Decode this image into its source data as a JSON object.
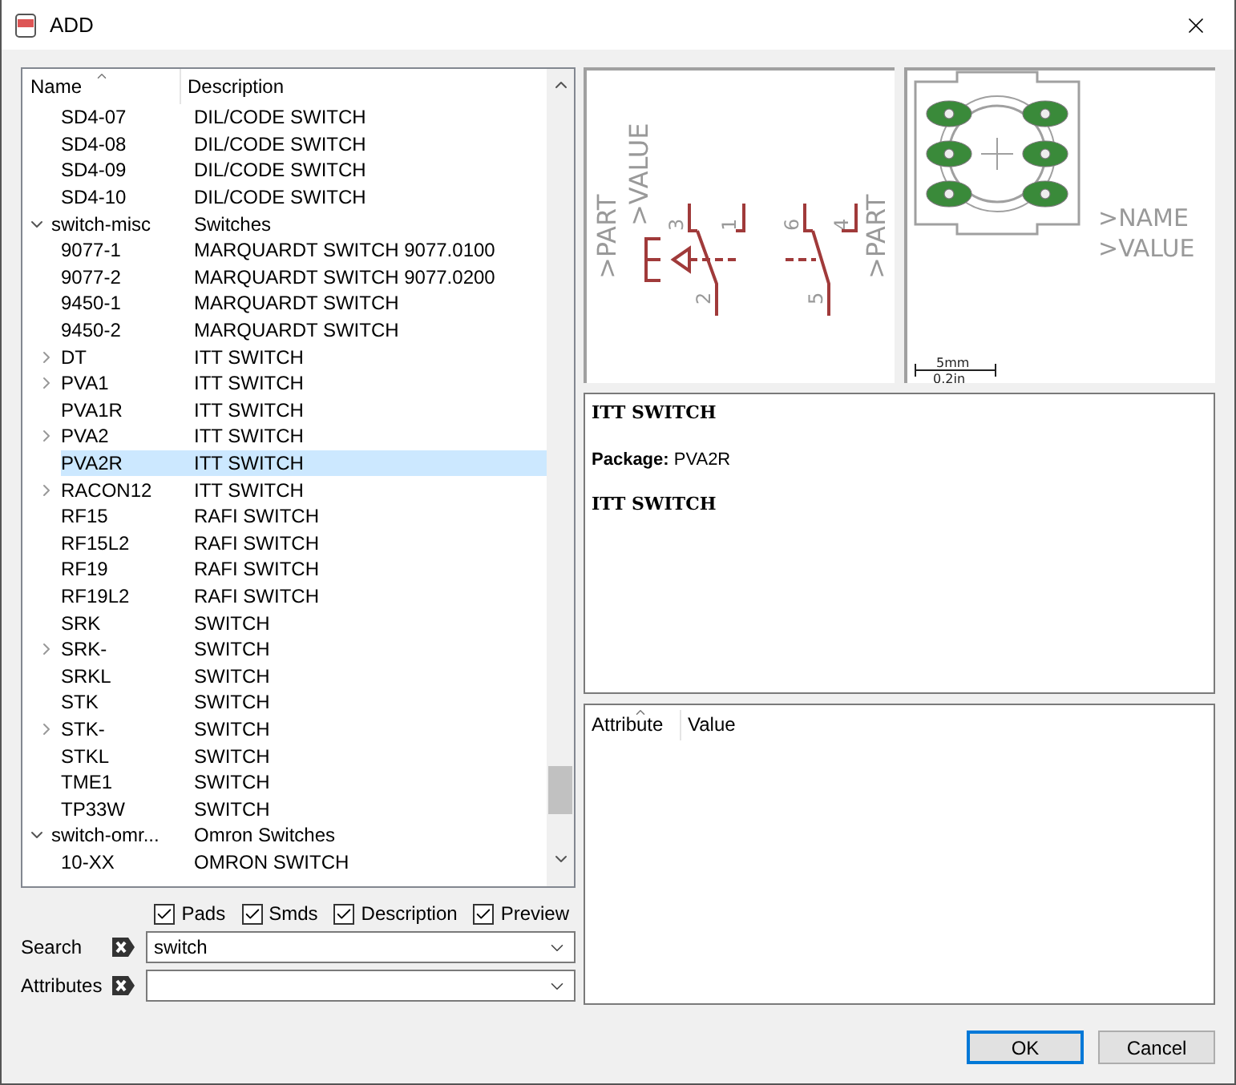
{
  "window": {
    "title": "ADD"
  },
  "tree": {
    "columns": [
      "Name",
      "Description"
    ],
    "rows": [
      {
        "children": [
          {
            "name": "SD4-07",
            "description": "DIL/CODE SWITCH",
            "selected": false
          },
          {
            "name": "SD4-08",
            "description": "DIL/CODE SWITCH",
            "selected": false
          },
          {
            "name": "SD4-09",
            "description": "DIL/CODE SWITCH",
            "selected": false
          },
          {
            "name": "SD4-10",
            "description": "DIL/CODE SWITCH",
            "selected": false
          }
        ]
      },
      {
        "name": "switch-misc",
        "description": "Switches",
        "expanded": true,
        "selected": false,
        "children": [
          {
            "name": "9077-1",
            "description": "MARQUARDT SWITCH 9077.0100",
            "selected": false
          },
          {
            "name": "9077-2",
            "description": "MARQUARDT SWITCH 9077.0200",
            "selected": false
          },
          {
            "name": "9450-1",
            "description": "MARQUARDT SWITCH",
            "selected": false
          },
          {
            "name": "9450-2",
            "description": "MARQUARDT SWITCH",
            "selected": false
          },
          {
            "name": "DT",
            "description": "ITT SWITCH",
            "expanded": false,
            "selected": false
          },
          {
            "name": "PVA1",
            "description": "ITT SWITCH",
            "expanded": false,
            "selected": false
          },
          {
            "name": "PVA1R",
            "description": "ITT SWITCH",
            "selected": false
          },
          {
            "name": "PVA2",
            "description": "ITT SWITCH",
            "expanded": false,
            "selected": false
          },
          {
            "name": "PVA2R",
            "description": "ITT SWITCH",
            "selected": true
          },
          {
            "name": "RACON12",
            "description": "ITT SWITCH",
            "expanded": false,
            "selected": false
          },
          {
            "name": "RF15",
            "description": "RAFI SWITCH",
            "selected": false
          },
          {
            "name": "RF15L2",
            "description": "RAFI SWITCH",
            "selected": false
          },
          {
            "name": "RF19",
            "description": "RAFI SWITCH",
            "selected": false
          },
          {
            "name": "RF19L2",
            "description": "RAFI SWITCH",
            "selected": false
          },
          {
            "name": "SRK",
            "description": "SWITCH",
            "selected": false
          },
          {
            "name": "SRK-",
            "description": "SWITCH",
            "expanded": false,
            "selected": false
          },
          {
            "name": "SRKL",
            "description": "SWITCH",
            "selected": false
          },
          {
            "name": "STK",
            "description": "SWITCH",
            "selected": false
          },
          {
            "name": "STK-",
            "description": "SWITCH",
            "expanded": false,
            "selected": false
          },
          {
            "name": "STKL",
            "description": "SWITCH",
            "selected": false
          },
          {
            "name": "TME1",
            "description": "SWITCH",
            "selected": false
          },
          {
            "name": "TP33W",
            "description": "SWITCH",
            "selected": false
          }
        ]
      },
      {
        "name": "switch-omr...",
        "description": "Omron Switches",
        "expanded": true,
        "selected": false,
        "children": [
          {
            "name": "10-XX",
            "description": "OMRON SWITCH",
            "selected": false
          }
        ]
      }
    ]
  },
  "options": [
    {
      "label": "Pads",
      "checked": true
    },
    {
      "label": "Smds",
      "checked": true
    },
    {
      "label": "Description",
      "checked": true
    },
    {
      "label": "Preview",
      "checked": true
    }
  ],
  "search": {
    "label": "Search",
    "value": "switch"
  },
  "attributes_filter": {
    "label": "Attributes"
  },
  "symbol_preview": {
    "part_left": ">PART",
    "value": ">VALUE",
    "part_right": ">PART",
    "pins": [
      "3",
      "1",
      "2",
      "6",
      "4",
      "5"
    ]
  },
  "package_preview": {
    "name": ">NAME",
    "value": ">VALUE",
    "scale_metric": "5mm",
    "scale_imperial": "0.2in"
  },
  "description": {
    "title": "ITT SWITCH",
    "package": "**Package:** PVA2R",
    "text": "ITT SWITCH"
  },
  "attributes_table": {
    "columns": [
      "Attribute",
      "Value"
    ]
  },
  "buttons": [
    {
      "label": "OK",
      "kind": "default"
    },
    {
      "label": "Cancel",
      "kind": "normal"
    }
  ]
}
